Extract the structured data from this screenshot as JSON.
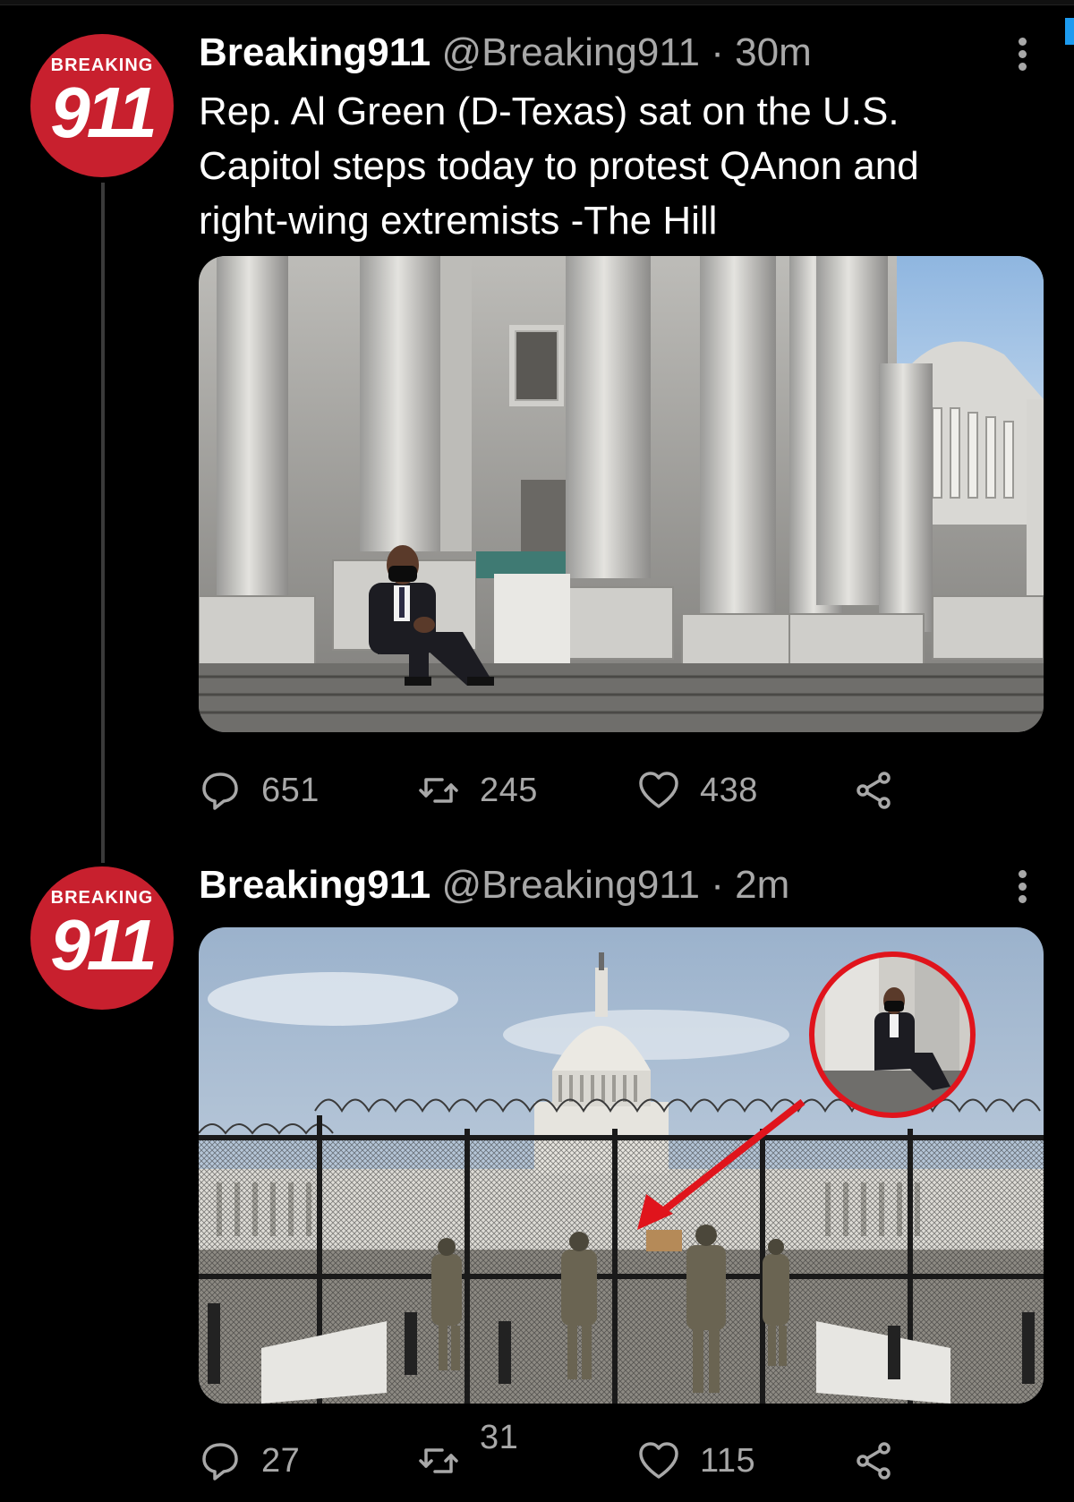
{
  "tweets": [
    {
      "avatar": {
        "top_text": "BREAKING",
        "number": "911"
      },
      "name": "Breaking911",
      "handle": "@Breaking911",
      "separator": "·",
      "time": "30m",
      "text": "Rep. Al Green (D-Texas) sat on the U.S. Capitol steps today to protest QAnon and right-wing extremists -The Hill",
      "media_description": "photo of man in suit and mask sitting on Capitol steps",
      "replies": "651",
      "retweets": "245",
      "likes": "438"
    },
    {
      "avatar": {
        "top_text": "BREAKING",
        "number": "911"
      },
      "name": "Breaking911",
      "handle": "@Breaking911",
      "separator": "·",
      "time": "2m",
      "text": "",
      "media_description": "photo of Capitol behind fence with soldiers; red arrow and circle inset",
      "replies": "27",
      "retweets": "31",
      "likes": "115"
    }
  ],
  "icons": {
    "reply": "reply-icon",
    "retweet": "retweet-icon",
    "like": "heart-icon",
    "share": "share-icon",
    "more": "more-vertical-icon"
  },
  "colors": {
    "background": "#000000",
    "text": "#ffffff",
    "secondary": "#a8a8a8",
    "avatar": "#c8202e",
    "annotation": "#e0141c"
  }
}
